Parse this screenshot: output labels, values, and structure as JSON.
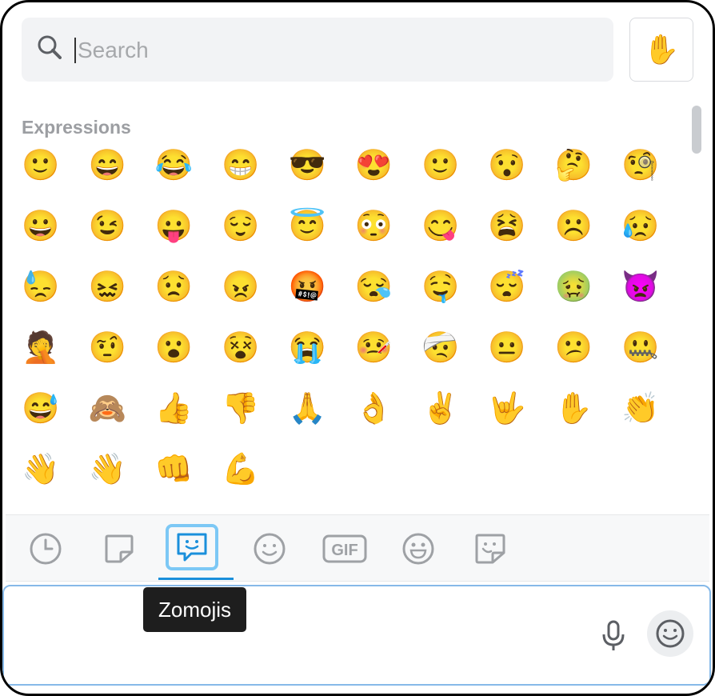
{
  "search": {
    "placeholder": "Search",
    "value": ""
  },
  "skin_tone_button": {
    "emoji": "✋"
  },
  "section": {
    "label": "Expressions"
  },
  "emojis": [
    "🙂",
    "😄",
    "😂",
    "😁",
    "😎",
    "😍",
    "🙂",
    "😯",
    "🤔",
    "🧐",
    "😀",
    "😉",
    "😛",
    "😌",
    "😇",
    "😳",
    "😋",
    "😫",
    "☹️",
    "😥",
    "😓",
    "😖",
    "😟",
    "😠",
    "🤬",
    "😪",
    "🤤",
    "😴",
    "🤢",
    "👿",
    "🤦",
    "🤨",
    "😮",
    "😵",
    "😭",
    "🤒",
    "🤕",
    "😐",
    "😕",
    "🤐",
    "😅",
    "🙈",
    "👍",
    "👎",
    "🙏",
    "👌",
    "✌️",
    "🤟",
    "✋",
    "👏",
    "👋",
    "👋",
    "👊",
    "💪"
  ],
  "tabs": [
    {
      "name": "tab-recent",
      "icon": "clock-icon"
    },
    {
      "name": "tab-stickers",
      "icon": "sticker-icon"
    },
    {
      "name": "tab-zomojis",
      "icon": "zomoji-icon",
      "active": true
    },
    {
      "name": "tab-emoji",
      "icon": "smiley-icon"
    },
    {
      "name": "tab-gif",
      "icon": "gif-icon",
      "label": "GIF"
    },
    {
      "name": "tab-emoticons",
      "icon": "grin-icon"
    },
    {
      "name": "tab-custom-stickers",
      "icon": "sticker-face-icon"
    }
  ],
  "tooltip": {
    "text": "Zomojis"
  },
  "colors": {
    "accent": "#1a8fdb",
    "active_tab_border": "#7cc8f5",
    "emoji_yellow": "#f7c23a"
  }
}
